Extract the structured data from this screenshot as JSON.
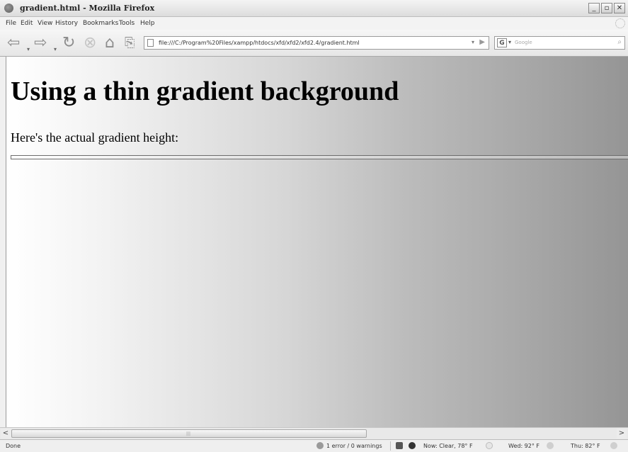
{
  "window": {
    "title": "gradient.html - Mozilla Firefox",
    "minimize_glyph": "_",
    "maximize_glyph": "▫",
    "close_glyph": "✕"
  },
  "menu": {
    "items": [
      "File",
      "Edit",
      "View",
      "History",
      "Bookmarks",
      "Tools",
      "Help"
    ]
  },
  "toolbar": {
    "back_glyph": "⇦",
    "forward_glyph": "⇨",
    "dropdown_glyph": "▾",
    "reload_glyph": "↻",
    "stop_glyph": "⊗",
    "home_glyph": "⌂",
    "bookmark_glyph": "⎘",
    "url": "file:///C:/Program%20Files/xampp/htdocs/xfd/xfd2/xfd2.4/gradient.html",
    "go_glyph": "▶",
    "search_engine_glyph": "G",
    "search_placeholder": "Google",
    "search_glyph": "⌕"
  },
  "page": {
    "heading": "Using a thin gradient background",
    "paragraph": "Here's the actual gradient height:"
  },
  "scrollbar": {
    "left_glyph": "<",
    "right_glyph": ">",
    "grip_glyph": "|||"
  },
  "status": {
    "text": "Done",
    "errors": "1 error / 0 warnings",
    "weather_now": "Now: Clear, 78° F",
    "weather_wed": "Wed: 92° F",
    "weather_thu": "Thu: 82° F"
  }
}
